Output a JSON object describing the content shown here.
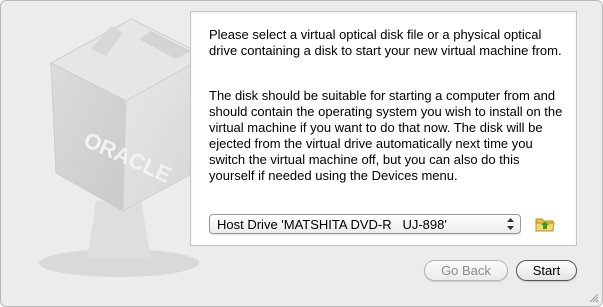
{
  "content": {
    "paragraph1": "Please select a virtual optical disk file or a physical optical drive containing a disk to start your new virtual machine from.",
    "paragraph2": "The disk should be suitable for starting a computer from and should contain the operating system you wish to install on the virtual machine if you want to do that now. The disk will be ejected from the virtual drive automatically next time you switch the virtual machine off, but you can also do this yourself if needed using the Devices menu."
  },
  "drive_select": {
    "selected_value": "Host Drive 'MATSHITA DVD-R   UJ-898'"
  },
  "buttons": {
    "back_label": "Go Back",
    "start_label": "Start"
  },
  "logo": {
    "text": "ORACLE"
  },
  "icons": {
    "drive_selector": "folder-open-icon",
    "stepper": "up-down-stepper-icon"
  },
  "colors": {
    "window_bg": "#ececec",
    "panel_bg": "#ffffff",
    "folder_icon": "#e8c14a",
    "folder_arrow": "#3a9a2a"
  }
}
